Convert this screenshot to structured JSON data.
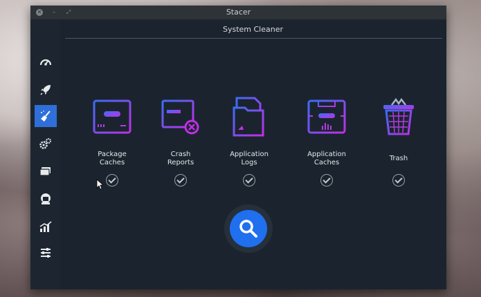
{
  "window": {
    "title": "Stacer"
  },
  "sidebar": {
    "items": [
      {
        "name": "Dashboard",
        "icon": "speedometer-icon"
      },
      {
        "name": "Startup Apps",
        "icon": "rocket-icon"
      },
      {
        "name": "System Cleaner",
        "icon": "broom-icon",
        "active": true
      },
      {
        "name": "Services",
        "icon": "gears-icon"
      },
      {
        "name": "Processes",
        "icon": "cards-icon"
      },
      {
        "name": "Uninstaller",
        "icon": "package-icon"
      },
      {
        "name": "Resources",
        "icon": "chart-icon"
      },
      {
        "name": "Settings",
        "icon": "sliders-icon"
      }
    ]
  },
  "main": {
    "title": "System Cleaner",
    "categories": [
      {
        "label_line1": "Package",
        "label_line2": "Caches",
        "checked": true
      },
      {
        "label_line1": "Crash",
        "label_line2": "Reports",
        "checked": true
      },
      {
        "label_line1": "Application",
        "label_line2": "Logs",
        "checked": true
      },
      {
        "label_line1": "Application",
        "label_line2": "Caches",
        "checked": true
      },
      {
        "label_line1": "Trash",
        "label_line2": "",
        "checked": true
      }
    ],
    "scan_button": {
      "icon": "search-icon"
    }
  },
  "colors": {
    "accent": "#2f6fd9",
    "scan": "#1f6fef",
    "icon_gradient_start": "#3b6ef5",
    "icon_gradient_end": "#c22ee8"
  }
}
